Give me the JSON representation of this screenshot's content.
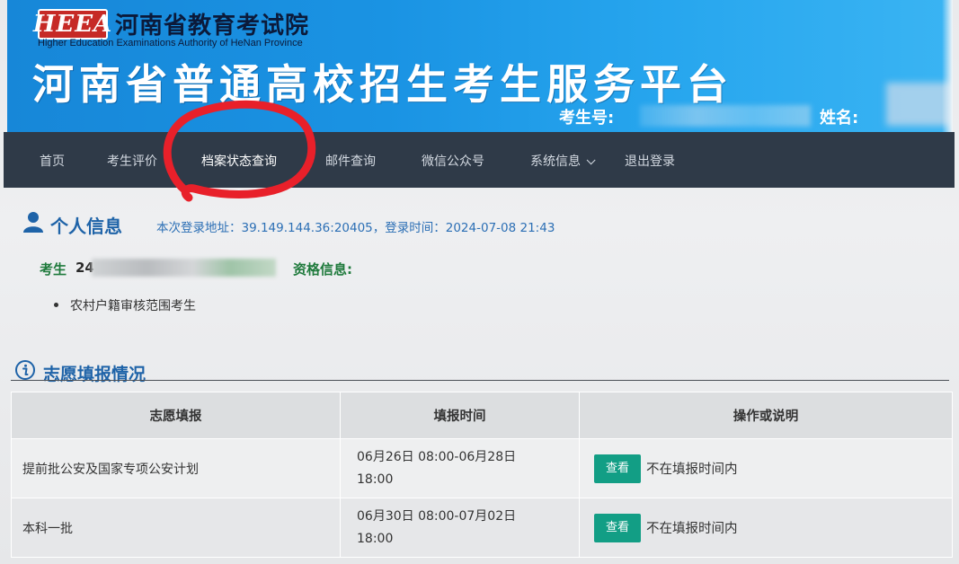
{
  "header": {
    "logo_text": "HEEA",
    "org_name_cn": "河南省教育考试院",
    "org_name_en": "Higher Education Examinations Authority of HeNan Province",
    "platform_title": "河南省普通高校招生考生服务平台",
    "candidate_no_label": "考生号:",
    "name_label": "姓名:"
  },
  "nav": {
    "items": [
      {
        "label": "首页"
      },
      {
        "label": "考生评价"
      },
      {
        "label": "档案状态查询"
      },
      {
        "label": "邮件查询"
      },
      {
        "label": "微信公众号"
      },
      {
        "label": "系统信息"
      },
      {
        "label": "退出登录"
      }
    ]
  },
  "personal": {
    "title": "个人信息",
    "login_info": "本次登录地址：39.149.144.36:20405，登录时间：2024-07-08 21:43",
    "candidate_prefix": "考生",
    "candidate_partial": "24",
    "qualification_label": "资格信息:",
    "qualifications": [
      "农村户籍审核范围考生"
    ]
  },
  "volunteer": {
    "title": "志愿填报情况",
    "columns": [
      "志愿填报",
      "填报时间",
      "操作或说明"
    ],
    "rows": [
      {
        "batch": "提前批公安及国家专项公安计划",
        "time_line1": "06月26日 08:00-06月28日",
        "time_line2": "18:00",
        "button": "查看",
        "note": "不在填报时间内"
      },
      {
        "batch": "本科一批",
        "time_line1": "06月30日 08:00-07月02日",
        "time_line2": "18:00",
        "button": "查看",
        "note": "不在填报时间内"
      }
    ]
  },
  "colors": {
    "banner": "#1a93e3",
    "nav_bg": "#2f3a48",
    "title_blue": "#1e63a8",
    "green_label": "#1f7a3c",
    "button_teal": "#129e85",
    "annotation_red": "#e8202a"
  },
  "icons": {
    "person": "person-icon",
    "info": "info-circle-icon",
    "dropdown": "chevron-down-icon"
  }
}
